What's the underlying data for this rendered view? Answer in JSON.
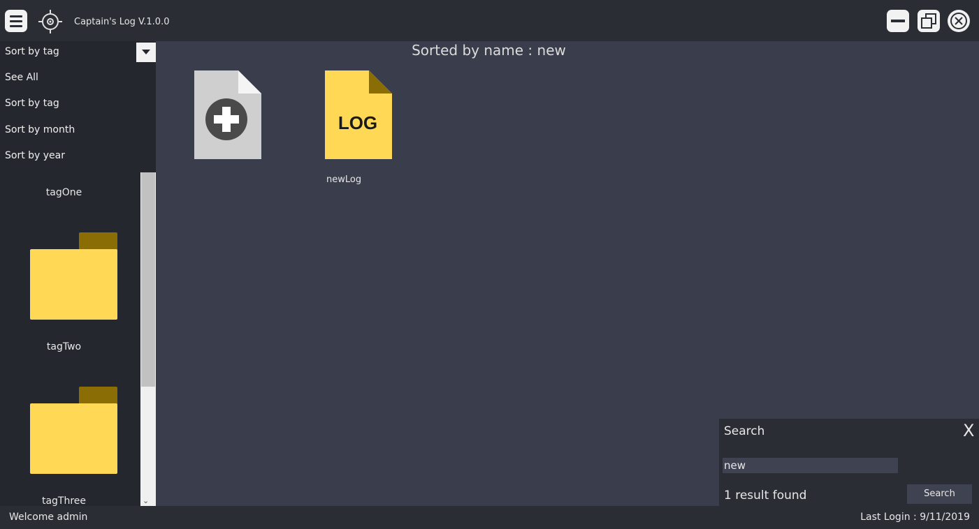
{
  "app": {
    "title": "Captain's Log V.1.0.0"
  },
  "icons": {
    "menu": "hamburger-icon",
    "logo": "compass-icon",
    "minimize": "minimize-icon",
    "restore": "restore-icon",
    "close": "close-icon",
    "new_log": "add-file-icon",
    "log": "log-file-icon",
    "folder": "folder-icon"
  },
  "colors": {
    "background": "#3a3d4b",
    "panel": "#25272f",
    "titlebar": "#2b2d35",
    "folder": "#ffd955",
    "folder_tab": "#8a6d05",
    "log_file": "#ffd955"
  },
  "sort_dropdown": {
    "selected": "Sort by tag",
    "options": [
      "See All",
      "Sort by tag",
      "Sort by month",
      "Sort by year"
    ]
  },
  "sidebar": {
    "tags": [
      {
        "label": "tagOne"
      },
      {
        "label": "tagTwo"
      },
      {
        "label": "tagThree"
      }
    ]
  },
  "main": {
    "heading": "Sorted by name : new",
    "files": [
      {
        "label": "",
        "badge": ""
      },
      {
        "label": "newLog",
        "badge": "LOG"
      }
    ]
  },
  "search": {
    "title": "Search",
    "close_label": "X",
    "query": "new",
    "result_text": "1 result found",
    "button_label": "Search"
  },
  "status": {
    "welcome": "Welcome admin",
    "last_login": "Last Login : 9/11/2019"
  }
}
